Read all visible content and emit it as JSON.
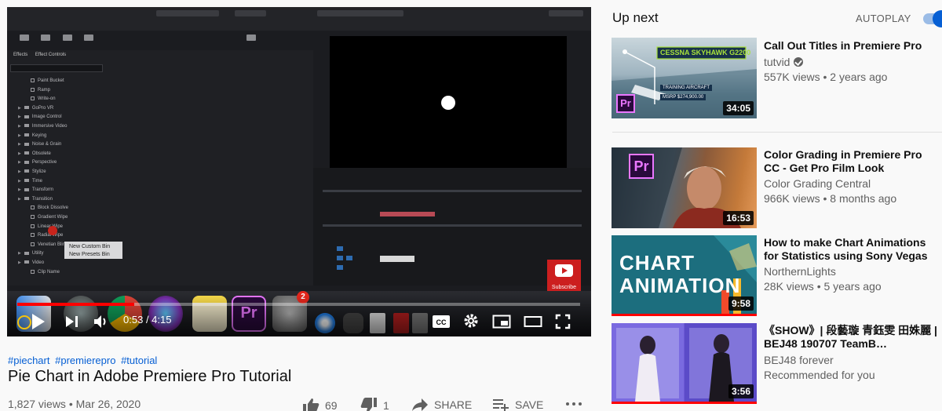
{
  "player": {
    "current_time": "0:53",
    "duration": "4:15",
    "progress_fraction": 0.208,
    "context_menu": [
      "New Custom Bin",
      "New Presets Bin"
    ],
    "editor_tabs": [
      "Effects",
      "Effect Controls"
    ],
    "effects_list": [
      "Paint Bucket",
      "Ramp",
      "Write-on",
      "GoPro VR",
      "Image Control",
      "Immersive Video",
      "Keying",
      "Noise & Grain",
      "Obsolete",
      "Perspective",
      "Stylize",
      "Time",
      "Transform",
      "Transition",
      "Block Dissolve",
      "Gradient Wipe",
      "Linear Wipe",
      "Radial Wipe",
      "Venetian Blinds",
      "Utility",
      "Video",
      "Clip Name"
    ],
    "subscribe_watermark": "Subscribe",
    "dock_badge": "2"
  },
  "video": {
    "tags": [
      "#piechart",
      "#premierepro",
      "#tutorial"
    ],
    "title": "Pie Chart in Adobe Premiere Pro Tutorial",
    "views": "1,827 views",
    "date": "Mar 26, 2020",
    "likes": "69",
    "dislikes": "1",
    "share_label": "SHARE",
    "save_label": "SAVE"
  },
  "sidebar": {
    "heading": "Up next",
    "autoplay_label": "AUTOPLAY",
    "autoplay_on": true,
    "videos": [
      {
        "title": "Call Out Titles in Premiere Pro",
        "channel": "tutvid",
        "verified": true,
        "stats": "557K views • 2 years ago",
        "duration": "34:05",
        "thumb_text": [
          "CESSNA SKYHAWK G2200",
          "TRAINING AIRCRAFT",
          "MSRP $274,900.00"
        ]
      },
      {
        "title": "Color Grading in Premiere Pro CC - Get Pro Film Look",
        "channel": "Color Grading Central",
        "stats": "966K views • 8 months ago",
        "duration": "16:53"
      },
      {
        "title": "How to make Chart Animations for Statistics using Sony Vegas",
        "channel": "NorthernLights",
        "stats": "28K views • 5 years ago",
        "duration": "9:58",
        "thumb_text": [
          "CHART",
          "ANIMATION"
        ],
        "watched_fraction": 1.0
      },
      {
        "title": "《SHOW》| 段藝璇 青鈺雯 田姝麗 | BEJ48 190707 TeamB…",
        "channel": "BEJ48 forever",
        "stats": "Recommended for you",
        "duration": "3:56",
        "watched_fraction": 1.0
      }
    ]
  },
  "colors": {
    "accent_red": "#ff0000",
    "link_blue": "#065fd4",
    "premiere_purple": "#ea77ff"
  }
}
